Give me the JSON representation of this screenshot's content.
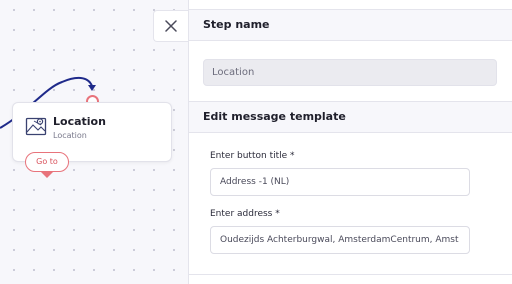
{
  "node": {
    "title": "Location",
    "subtitle": "Location",
    "goto_label": "Go to",
    "icon": "map-location-icon"
  },
  "close_icon": "close-icon",
  "panel": {
    "step_name_header": "Step name",
    "step_name_value": "Location",
    "template_header": "Edit message template",
    "button_title_label": "Enter button title *",
    "button_title_value": "Address -1 (NL)",
    "address_label": "Enter address *",
    "address_value": "Oudezijds Achterburgwal, AmsterdamCentrum, Amst"
  },
  "colors": {
    "connector": "#1f2a8a",
    "accent": "#e8737b",
    "canvas_bg": "#f7f7fb",
    "dots": "#c9c9d6"
  }
}
